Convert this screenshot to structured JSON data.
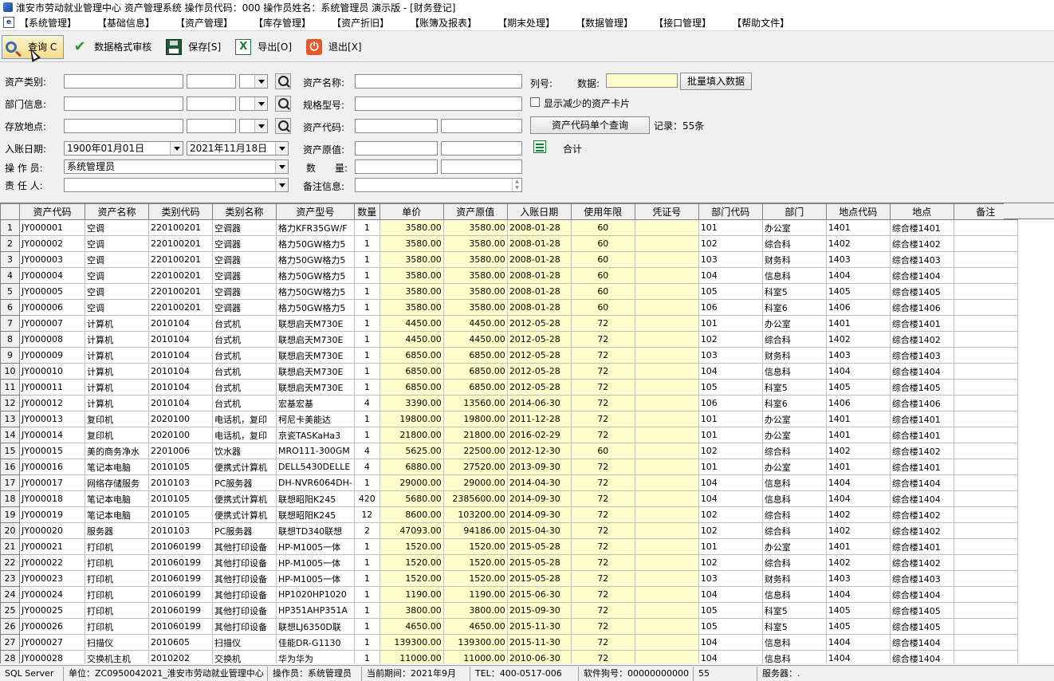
{
  "window": {
    "title": "淮安市劳动就业管理中心 资产管理系统 操作员代码：000 操作员姓名：系统管理员 演示版 - [财务登记]"
  },
  "menu": [
    "【系统管理】",
    "【基础信息】",
    "【资产管理】",
    "【库存管理】",
    "【资产折旧】",
    "【账簿及报表】",
    "【期末处理】",
    "【数据管理】",
    "【接口管理】",
    "【帮助文件】"
  ],
  "toolbar": {
    "query": "查询 C",
    "validate": "数据格式审核",
    "save": "保存[S]",
    "export": "导出[O]",
    "exit": "退出[X]"
  },
  "filters": {
    "asset_category_label": "资产类别:",
    "department_label": "部门信息:",
    "location_label": "存放地点:",
    "entry_date_label": "入账日期:",
    "entry_date_from": "1900年01月01日",
    "entry_date_to": "2021年11月18日",
    "operator_label": "操 作 员:",
    "operator_value": "系统管理员",
    "responsible_label": "责 任 人:",
    "asset_name_label": "资产名称:",
    "model_label": "规格型号:",
    "asset_code_label": "资产代码:",
    "original_value_label": "资产原值:",
    "quantity_label": "数　　量:",
    "remark_label": "备注信息:",
    "column_label": "列号:",
    "data_label": "数据:",
    "batch_fill_button": "批量填入数据",
    "show_reduced_label": "显示减少的资产卡片",
    "single_query_button": "资产代码单个查询",
    "record_count": "记录：55条",
    "total_label": "合计"
  },
  "grid": {
    "columns": [
      "资产代码",
      "资产名称",
      "类别代码",
      "类别名称",
      "资产型号",
      "数量",
      "单价",
      "资产原值",
      "入账日期",
      "使用年限",
      "凭证号",
      "部门代码",
      "部门",
      "地点代码",
      "地点",
      "备注"
    ],
    "rows": [
      [
        "1",
        "JY000001",
        "空调",
        "220100201",
        "空调器",
        "格力KFR35GW/F",
        "1",
        "3580.00",
        "3580.00",
        "2008-01-28",
        "60",
        "",
        "101",
        "办公室",
        "1401",
        "综合楼1401",
        ""
      ],
      [
        "2",
        "JY000002",
        "空调",
        "220100201",
        "空调器",
        "格力50GW格力5",
        "1",
        "3580.00",
        "3580.00",
        "2008-01-28",
        "60",
        "",
        "102",
        "综合科",
        "1402",
        "综合楼1402",
        ""
      ],
      [
        "3",
        "JY000003",
        "空调",
        "220100201",
        "空调器",
        "格力50GW格力5",
        "1",
        "3580.00",
        "3580.00",
        "2008-01-28",
        "60",
        "",
        "103",
        "财务科",
        "1403",
        "综合楼1403",
        ""
      ],
      [
        "4",
        "JY000004",
        "空调",
        "220100201",
        "空调器",
        "格力50GW格力5",
        "1",
        "3580.00",
        "3580.00",
        "2008-01-28",
        "60",
        "",
        "104",
        "信息科",
        "1404",
        "综合楼1404",
        ""
      ],
      [
        "5",
        "JY000005",
        "空调",
        "220100201",
        "空调器",
        "格力50GW格力5",
        "1",
        "3580.00",
        "3580.00",
        "2008-01-28",
        "60",
        "",
        "105",
        "科室5",
        "1405",
        "综合楼1405",
        ""
      ],
      [
        "6",
        "JY000006",
        "空调",
        "220100201",
        "空调器",
        "格力50GW格力5",
        "1",
        "3580.00",
        "3580.00",
        "2008-01-28",
        "60",
        "",
        "106",
        "科室6",
        "1406",
        "综合楼1406",
        ""
      ],
      [
        "7",
        "JY000007",
        "计算机",
        "2010104",
        "台式机",
        "联想启天M730E",
        "1",
        "4450.00",
        "4450.00",
        "2012-05-28",
        "72",
        "",
        "101",
        "办公室",
        "1401",
        "综合楼1401",
        ""
      ],
      [
        "8",
        "JY000008",
        "计算机",
        "2010104",
        "台式机",
        "联想启天M730E",
        "1",
        "4450.00",
        "4450.00",
        "2012-05-28",
        "72",
        "",
        "102",
        "综合科",
        "1402",
        "综合楼1402",
        ""
      ],
      [
        "9",
        "JY000009",
        "计算机",
        "2010104",
        "台式机",
        "联想启天M730E",
        "1",
        "6850.00",
        "6850.00",
        "2012-05-28",
        "72",
        "",
        "103",
        "财务科",
        "1403",
        "综合楼1403",
        ""
      ],
      [
        "10",
        "JY000010",
        "计算机",
        "2010104",
        "台式机",
        "联想启天M730E",
        "1",
        "6850.00",
        "6850.00",
        "2012-05-28",
        "72",
        "",
        "104",
        "信息科",
        "1404",
        "综合楼1404",
        ""
      ],
      [
        "11",
        "JY000011",
        "计算机",
        "2010104",
        "台式机",
        "联想启天M730E",
        "1",
        "6850.00",
        "6850.00",
        "2012-05-28",
        "72",
        "",
        "105",
        "科室5",
        "1405",
        "综合楼1405",
        ""
      ],
      [
        "12",
        "JY000012",
        "计算机",
        "2010104",
        "台式机",
        "宏基宏基",
        "4",
        "3390.00",
        "13560.00",
        "2014-06-30",
        "72",
        "",
        "106",
        "科室6",
        "1406",
        "综合楼1406",
        ""
      ],
      [
        "13",
        "JY000013",
        "复印机",
        "2020100",
        "电话机，复印",
        "柯尼卡美能达",
        "1",
        "19800.00",
        "19800.00",
        "2011-12-28",
        "72",
        "",
        "101",
        "办公室",
        "1401",
        "综合楼1401",
        ""
      ],
      [
        "14",
        "JY000014",
        "复印机",
        "2020100",
        "电话机，复印",
        "京瓷TASKaHa3",
        "1",
        "21800.00",
        "21800.00",
        "2016-02-29",
        "72",
        "",
        "101",
        "办公室",
        "1401",
        "综合楼1401",
        ""
      ],
      [
        "15",
        "JY000015",
        "美的商务净水",
        "2201006",
        "饮水器",
        "MRO111-300GM",
        "4",
        "5625.00",
        "22500.00",
        "2012-12-30",
        "60",
        "",
        "102",
        "综合科",
        "1402",
        "综合楼1402",
        ""
      ],
      [
        "16",
        "JY000016",
        "笔记本电脑",
        "2010105",
        "便携式计算机",
        "DELL5430DELLE",
        "4",
        "6880.00",
        "27520.00",
        "2013-09-30",
        "72",
        "",
        "101",
        "办公室",
        "1401",
        "综合楼1401",
        ""
      ],
      [
        "17",
        "JY000017",
        "网络存储服务",
        "2010103",
        "PC服务器",
        "DH-NVR6064DH-",
        "1",
        "29000.00",
        "29000.00",
        "2014-04-30",
        "72",
        "",
        "104",
        "信息科",
        "1404",
        "综合楼1404",
        ""
      ],
      [
        "18",
        "JY000018",
        "笔记本电脑",
        "2010105",
        "便携式计算机",
        "联想昭阳K245",
        "420",
        "5680.00",
        "2385600.00",
        "2014-09-30",
        "72",
        "",
        "104",
        "信息科",
        "1404",
        "综合楼1404",
        ""
      ],
      [
        "19",
        "JY000019",
        "笔记本电脑",
        "2010105",
        "便携式计算机",
        "联想昭阳K245",
        "12",
        "8600.00",
        "103200.00",
        "2014-09-30",
        "72",
        "",
        "102",
        "综合科",
        "1402",
        "综合楼1402",
        ""
      ],
      [
        "20",
        "JY000020",
        "服务器",
        "2010103",
        "PC服务器",
        "联想TD340联想",
        "2",
        "47093.00",
        "94186.00",
        "2015-04-30",
        "72",
        "",
        "102",
        "综合科",
        "1402",
        "综合楼1402",
        ""
      ],
      [
        "21",
        "JY000021",
        "打印机",
        "201060199",
        "其他打印设备",
        "HP-M1005一体",
        "1",
        "1520.00",
        "1520.00",
        "2015-05-28",
        "72",
        "",
        "101",
        "办公室",
        "1401",
        "综合楼1401",
        ""
      ],
      [
        "22",
        "JY000022",
        "打印机",
        "201060199",
        "其他打印设备",
        "HP-M1005一体",
        "1",
        "1520.00",
        "1520.00",
        "2015-05-28",
        "72",
        "",
        "102",
        "综合科",
        "1402",
        "综合楼1402",
        ""
      ],
      [
        "23",
        "JY000023",
        "打印机",
        "201060199",
        "其他打印设备",
        "HP-M1005一体",
        "1",
        "1520.00",
        "1520.00",
        "2015-05-28",
        "72",
        "",
        "103",
        "财务科",
        "1403",
        "综合楼1403",
        ""
      ],
      [
        "24",
        "JY000024",
        "打印机",
        "201060199",
        "其他打印设备",
        "HP1020HP1020",
        "1",
        "1190.00",
        "1190.00",
        "2015-06-30",
        "72",
        "",
        "104",
        "信息科",
        "1404",
        "综合楼1404",
        ""
      ],
      [
        "25",
        "JY000025",
        "打印机",
        "201060199",
        "其他打印设备",
        "HP351AHP351A",
        "1",
        "3800.00",
        "3800.00",
        "2015-09-30",
        "72",
        "",
        "105",
        "科室5",
        "1405",
        "综合楼1405",
        ""
      ],
      [
        "26",
        "JY000026",
        "打印机",
        "201060199",
        "其他打印设备",
        "联想LJ6350D联",
        "1",
        "4650.00",
        "4650.00",
        "2015-11-30",
        "72",
        "",
        "105",
        "科室5",
        "1405",
        "综合楼1405",
        ""
      ],
      [
        "27",
        "JY000027",
        "扫描仪",
        "2010605",
        "扫描仪",
        "佳能DR-G1130",
        "1",
        "139300.00",
        "139300.00",
        "2015-11-30",
        "72",
        "",
        "104",
        "信息科",
        "1404",
        "综合楼1404",
        ""
      ],
      [
        "28",
        "JY000028",
        "交换机主机",
        "2010202",
        "交换机",
        "华为华为",
        "1",
        "11000.00",
        "11000.00",
        "2010-06-30",
        "72",
        "",
        "104",
        "信息科",
        "1404",
        "综合楼1404",
        ""
      ]
    ]
  },
  "status": {
    "db": "SQL Server",
    "unit": "单位：ZC0950042021_淮安市劳动就业管理中心",
    "operator": "操作员：系统管理员",
    "period": "当前期间：2021年9月",
    "tel": "TEL：400-0517-006",
    "dongle": "软件狗号：00000000000",
    "count": "55",
    "server": "服务器：."
  },
  "colors": {
    "highlight": "#ffffcc",
    "panel": "#f0f0f0",
    "grid_line": "#c0c0c0"
  }
}
